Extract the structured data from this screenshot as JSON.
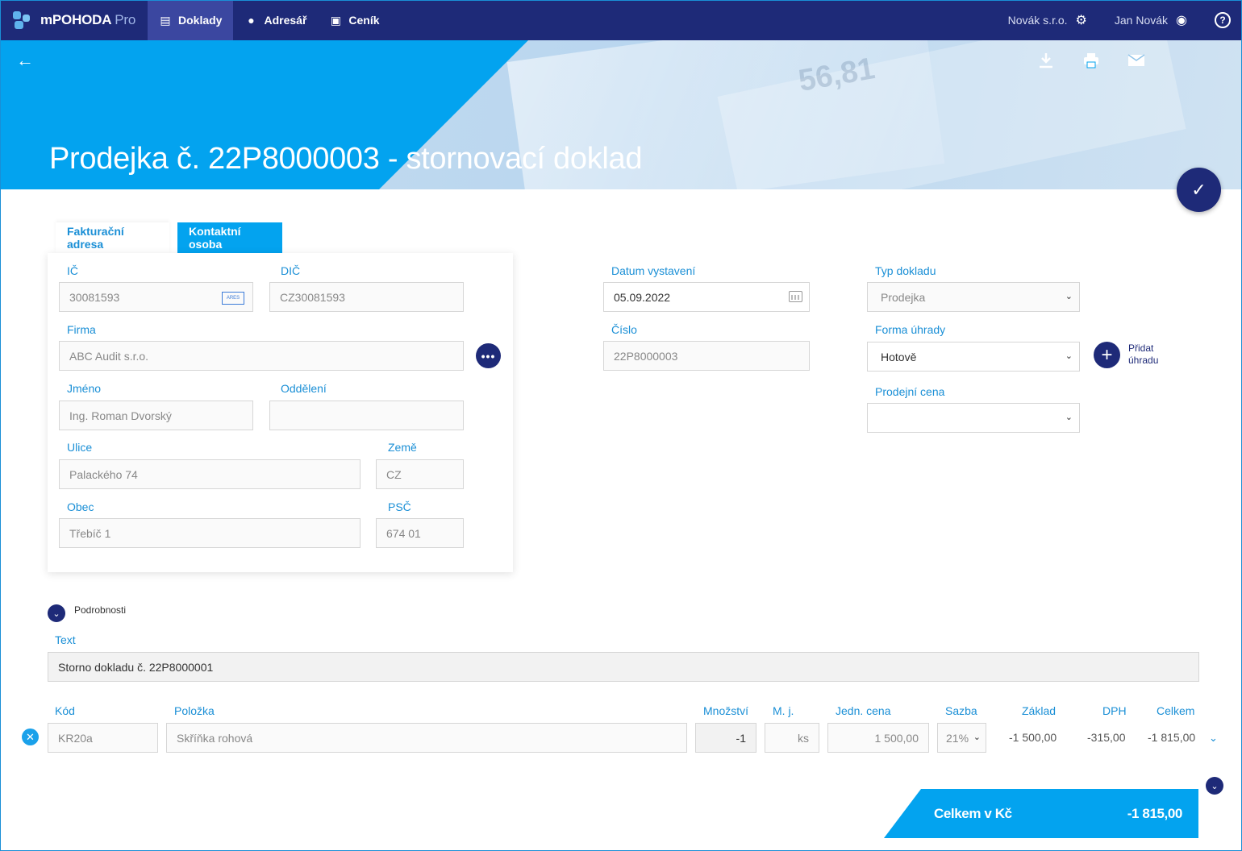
{
  "app": {
    "name": "mPOHODA",
    "edition": "Pro"
  },
  "nav": {
    "items": [
      {
        "label": "Doklady",
        "active": true
      },
      {
        "label": "Adresář"
      },
      {
        "label": "Ceník"
      }
    ],
    "company": "Novák s.r.o.",
    "user": "Jan Novák"
  },
  "hero": {
    "title": "Prodejka č. 22P8000003 - stornovací doklad"
  },
  "tabs": {
    "billing": "Fakturační adresa",
    "contact": "Kontaktní osoba"
  },
  "address": {
    "ico_label": "IČ",
    "ico": "30081593",
    "ares": "ARES",
    "dic_label": "DIČ",
    "dic": "CZ30081593",
    "firma_label": "Firma",
    "firma": "ABC Audit s.r.o.",
    "jmeno_label": "Jméno",
    "jmeno": "Ing. Roman Dvorský",
    "oddeleni_label": "Oddělení",
    "oddeleni": "",
    "ulice_label": "Ulice",
    "ulice": "Palackého 74",
    "zeme_label": "Země",
    "zeme": "CZ",
    "obec_label": "Obec",
    "obec": "Třebíč 1",
    "psc_label": "PSČ",
    "psc": "674 01"
  },
  "doc": {
    "datum_label": "Datum vystavení",
    "datum": "05.09.2022",
    "cislo_label": "Číslo",
    "cislo": "22P8000003",
    "typ_label": "Typ dokladu",
    "typ": "Prodejka",
    "forma_label": "Forma úhrady",
    "forma": "Hotově",
    "cena_label": "Prodejní cena",
    "cena": "",
    "add_payment": "Přidat úhradu"
  },
  "details": {
    "toggle": "Podrobnosti",
    "text_label": "Text",
    "text": "Storno dokladu č. 22P8000001"
  },
  "items": {
    "headers": {
      "kod": "Kód",
      "polozka": "Položka",
      "mnozstvi": "Množství",
      "mj": "M. j.",
      "cena": "Jedn. cena",
      "sazba": "Sazba",
      "zaklad": "Základ",
      "dph": "DPH",
      "celkem": "Celkem"
    },
    "rows": [
      {
        "kod": "KR20a",
        "polozka": "Skříňka rohová",
        "mnozstvi": "-1",
        "mj": "ks",
        "cena": "1 500,00",
        "sazba": "21%",
        "zaklad": "-1 500,00",
        "dph": "-315,00",
        "celkem": "-1 815,00"
      }
    ]
  },
  "total": {
    "label": "Celkem v Kč",
    "value": "-1 815,00"
  },
  "colors": {
    "navy": "#1e2a78",
    "accent": "#03a3ef",
    "label": "#1a8fd6"
  }
}
